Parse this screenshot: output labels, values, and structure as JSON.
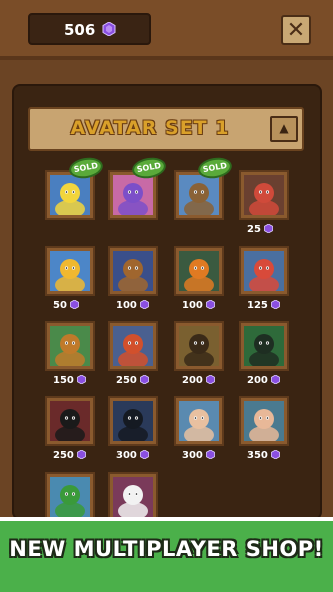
{
  "currency": {
    "count": "506",
    "icon": "purple-gem-icon",
    "gem_color": "#8a4fe0"
  },
  "header": {
    "close_label": "✕"
  },
  "section": {
    "title": "AVATAR SET 1",
    "collapse_icon": "▲"
  },
  "avatars": [
    {
      "name": "duck",
      "sold": true,
      "sold_label": "SOLD",
      "bg": "#4a7fc0",
      "fg": "#f2d53c"
    },
    {
      "name": "robot",
      "sold": true,
      "sold_label": "SOLD",
      "bg": "#c86aa6",
      "fg": "#7c4fc8"
    },
    {
      "name": "eagle",
      "sold": true,
      "sold_label": "SOLD",
      "bg": "#5a8ac0",
      "fg": "#8a6236"
    },
    {
      "name": "octopus",
      "sold": false,
      "price": "25",
      "bg": "#6a4030",
      "fg": "#d04a3a"
    },
    {
      "name": "star",
      "sold": false,
      "price": "50",
      "bg": "#4c86c8",
      "fg": "#f0b830"
    },
    {
      "name": "dragon-cartoon",
      "sold": false,
      "price": "100",
      "bg": "#3a4f8a",
      "fg": "#a0662e"
    },
    {
      "name": "pumpkin",
      "sold": false,
      "price": "100",
      "bg": "#3a5a40",
      "fg": "#e07a22"
    },
    {
      "name": "astronaut",
      "sold": false,
      "price": "125",
      "bg": "#4a6fa0",
      "fg": "#d84a3a"
    },
    {
      "name": "tiki",
      "sold": false,
      "price": "150",
      "bg": "#4a8a4a",
      "fg": "#c07a2a"
    },
    {
      "name": "red-dragon",
      "sold": false,
      "price": "250",
      "bg": "#4a6090",
      "fg": "#d2502c"
    },
    {
      "name": "ninja-tan",
      "sold": false,
      "price": "200",
      "bg": "#7a6030",
      "fg": "#3a2a18"
    },
    {
      "name": "ninja-green",
      "sold": false,
      "price": "200",
      "bg": "#2e6a3a",
      "fg": "#1e2e22"
    },
    {
      "name": "ninja-red",
      "sold": false,
      "price": "250",
      "bg": "#6a2a2a",
      "fg": "#1a1a1a"
    },
    {
      "name": "ninja-blue",
      "sold": false,
      "price": "300",
      "bg": "#2a3a5a",
      "fg": "#151a22"
    },
    {
      "name": "woman-dark-hair",
      "sold": false,
      "price": "300",
      "bg": "#5a8ab0",
      "fg": "#e8c0a0"
    },
    {
      "name": "woman-blue-hair",
      "sold": false,
      "price": "350",
      "bg": "#4a7a90",
      "fg": "#e8b898"
    },
    {
      "name": "girl-green-hair",
      "sold": false,
      "bg": "#4a8ab0",
      "fg": "#3a9a3a"
    },
    {
      "name": "fox-mask",
      "sold": false,
      "bg": "#7a3a5a",
      "fg": "#f2f2f2"
    }
  ],
  "footer": {
    "banner_text": "NEW MULTIPLAYER SHOP!"
  }
}
